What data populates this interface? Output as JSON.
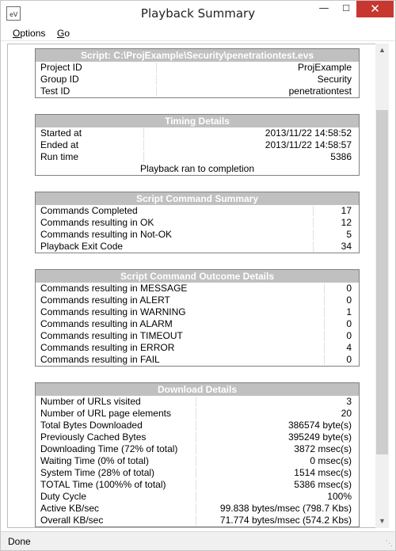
{
  "window": {
    "title": "Playback Summary",
    "app_icon_text": "eV"
  },
  "menu": {
    "options": "Options",
    "go": "Go"
  },
  "script_panel": {
    "header": "Script: C:\\ProjExample\\Security\\penetrationtest.evs",
    "rows": [
      {
        "label": "Project ID",
        "value": "ProjExample"
      },
      {
        "label": "Group ID",
        "value": "Security"
      },
      {
        "label": "Test ID",
        "value": "penetrationtest"
      }
    ]
  },
  "timing_panel": {
    "header": "Timing Details",
    "rows": [
      {
        "label": "Started at",
        "value": "2013/11/22 14:58:52"
      },
      {
        "label": "Ended at",
        "value": "2013/11/22 14:58:57"
      },
      {
        "label": "Run time",
        "value": "5386"
      }
    ],
    "footer": "Playback ran to completion"
  },
  "command_summary_panel": {
    "header": "Script Command Summary",
    "rows": [
      {
        "label": "Commands Completed",
        "value": "17"
      },
      {
        "label": "Commands resulting in OK",
        "value": "12"
      },
      {
        "label": "Commands resulting in Not-OK",
        "value": "5"
      },
      {
        "label": "Playback Exit Code",
        "value": "34"
      }
    ]
  },
  "outcome_panel": {
    "header": "Script Command Outcome Details",
    "rows": [
      {
        "label": "Commands resulting in MESSAGE",
        "value": "0"
      },
      {
        "label": "Commands resulting in ALERT",
        "value": "0"
      },
      {
        "label": "Commands resulting in WARNING",
        "value": "1"
      },
      {
        "label": "Commands resulting in ALARM",
        "value": "0"
      },
      {
        "label": "Commands resulting in TIMEOUT",
        "value": "0"
      },
      {
        "label": "Commands resulting in ERROR",
        "value": "4"
      },
      {
        "label": "Commands resulting in FAIL",
        "value": "0"
      }
    ]
  },
  "download_panel": {
    "header": "Download Details",
    "rows": [
      {
        "label": "Number of URLs visited",
        "value": "3"
      },
      {
        "label": "Number of URL page elements",
        "value": "20"
      },
      {
        "label": "Total Bytes Downloaded",
        "value": "386574 byte(s)"
      },
      {
        "label": "Previously Cached Bytes",
        "value": "395249 byte(s)"
      },
      {
        "label": "Downloading Time (72% of total)",
        "value": "3872 msec(s)"
      },
      {
        "label": "Waiting Time (0% of total)",
        "value": "0 msec(s)"
      },
      {
        "label": "System Time (28% of total)",
        "value": "1514 msec(s)"
      },
      {
        "label": "TOTAL Time (100%% of total)",
        "value": "5386 msec(s)"
      },
      {
        "label": "Duty Cycle",
        "value": "100%"
      },
      {
        "label": "Active KB/sec",
        "value": "99.838 bytes/msec (798.7 Kbs)"
      },
      {
        "label": "Overall KB/sec",
        "value": "71.774 bytes/msec (574.2 Kbs)"
      }
    ]
  },
  "statusbar": {
    "text": "Done"
  },
  "icons": {
    "minimize": "minimize-icon",
    "maximize": "maximize-icon",
    "close": "close-icon",
    "scroll_up": "chevron-up-icon",
    "scroll_down": "chevron-down-icon"
  }
}
